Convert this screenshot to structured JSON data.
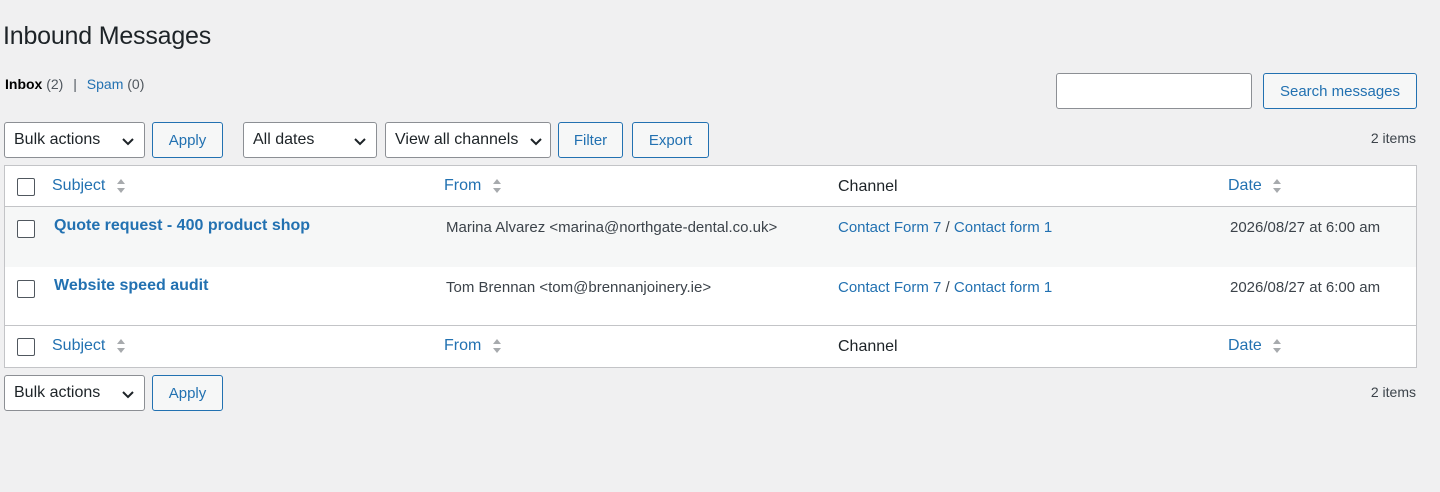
{
  "page": {
    "title": "Inbound Messages"
  },
  "views": {
    "inbox_label": "Inbox",
    "inbox_count": "(2)",
    "separator": "|",
    "spam_label": "Spam",
    "spam_count": "(0)"
  },
  "search": {
    "value": "",
    "placeholder": "",
    "button_label": "Search messages"
  },
  "toolbar_top": {
    "bulk_actions": "Bulk actions",
    "apply_label": "Apply",
    "dates_select": "All dates",
    "channels_select": "View all channels",
    "filter_label": "Filter",
    "export_label": "Export",
    "items_count": "2 items"
  },
  "toolbar_bottom": {
    "bulk_actions": "Bulk actions",
    "apply_label": "Apply",
    "items_count": "2 items"
  },
  "table": {
    "columns": {
      "subject": "Subject",
      "from": "From",
      "channel": "Channel",
      "date": "Date"
    },
    "rows": [
      {
        "subject": "Quote request - 400 product shop",
        "from": "Marina Alvarez <marina@northgate-dental.co.uk>",
        "channel_primary": "Contact Form 7",
        "channel_sep": "/",
        "channel_secondary": "Contact form 1",
        "date": "2026/08/27 at 6:00 am"
      },
      {
        "subject": "Website speed audit",
        "from": "Tom Brennan <tom@brennanjoinery.ie>",
        "channel_primary": "Contact Form 7",
        "channel_sep": "/",
        "channel_secondary": "Contact form 1",
        "date": "2026/08/27 at 6:00 am"
      }
    ]
  },
  "icons": {
    "chevron": "chevron-down-icon",
    "sort": "sort-arrows-icon"
  },
  "colors": {
    "accent": "#2271b1",
    "background": "#f0f0f1",
    "border": "#c3c4c7"
  }
}
